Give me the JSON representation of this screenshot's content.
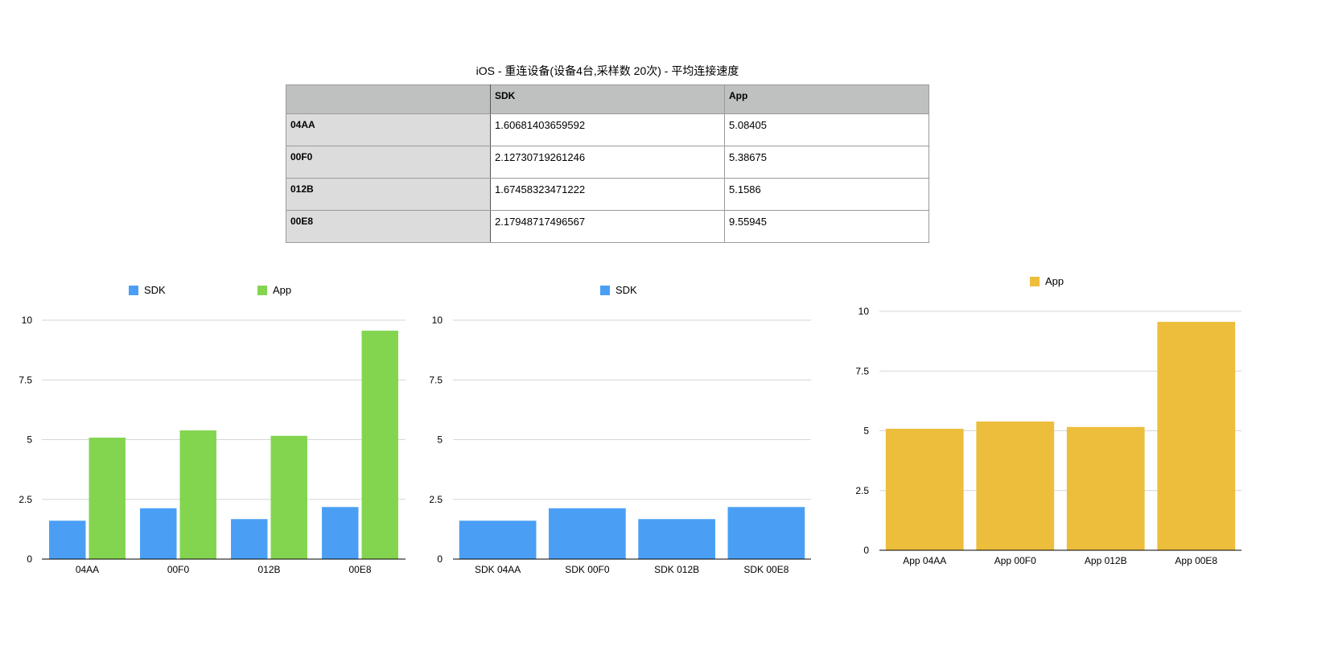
{
  "table": {
    "title": "iOS - 重连设备(设备4台,采样数 20次) - 平均连接速度",
    "header": [
      "",
      "SDK",
      "App"
    ],
    "rows": [
      {
        "label": "04AA",
        "sdk": "1.60681403659592",
        "app": "5.08405"
      },
      {
        "label": "00F0",
        "sdk": "2.12730719261246",
        "app": "5.38675"
      },
      {
        "label": "012B",
        "sdk": "1.67458323471222",
        "app": "5.1586"
      },
      {
        "label": "00E8",
        "sdk": "2.17948717496567",
        "app": "9.55945"
      }
    ]
  },
  "chart_data": [
    {
      "type": "bar",
      "categories": [
        "04AA",
        "00F0",
        "012B",
        "00E8"
      ],
      "series": [
        {
          "name": "SDK",
          "values": [
            1.60681403659592,
            2.12730719261246,
            1.67458323471222,
            2.17948717496567
          ],
          "color": "#4a9ff5"
        },
        {
          "name": "App",
          "values": [
            5.08405,
            5.38675,
            5.1586,
            9.55945
          ],
          "color": "#83d550"
        }
      ],
      "yticks": [
        "0",
        "2.5",
        "5",
        "7.5",
        "10"
      ],
      "ylim": [
        0,
        10
      ],
      "grid": true,
      "legend": "top"
    },
    {
      "type": "bar",
      "categories": [
        "SDK 04AA",
        "SDK 00F0",
        "SDK 012B",
        "SDK 00E8"
      ],
      "series": [
        {
          "name": "SDK",
          "values": [
            1.60681403659592,
            2.12730719261246,
            1.67458323471222,
            2.17948717496567
          ],
          "color": "#4a9ff5"
        }
      ],
      "yticks": [
        "0",
        "2.5",
        "5",
        "7.5",
        "10"
      ],
      "ylim": [
        0,
        10
      ],
      "grid": true,
      "legend": "top"
    },
    {
      "type": "bar",
      "categories": [
        "App 04AA",
        "App 00F0",
        "App 012B",
        "App 00E8"
      ],
      "series": [
        {
          "name": "App",
          "values": [
            5.08405,
            5.38675,
            5.1586,
            9.55945
          ],
          "color": "#edbd3c"
        }
      ],
      "yticks": [
        "0",
        "2.5",
        "5",
        "7.5",
        "10"
      ],
      "ylim": [
        0,
        10
      ],
      "grid": true,
      "legend": "top"
    }
  ]
}
